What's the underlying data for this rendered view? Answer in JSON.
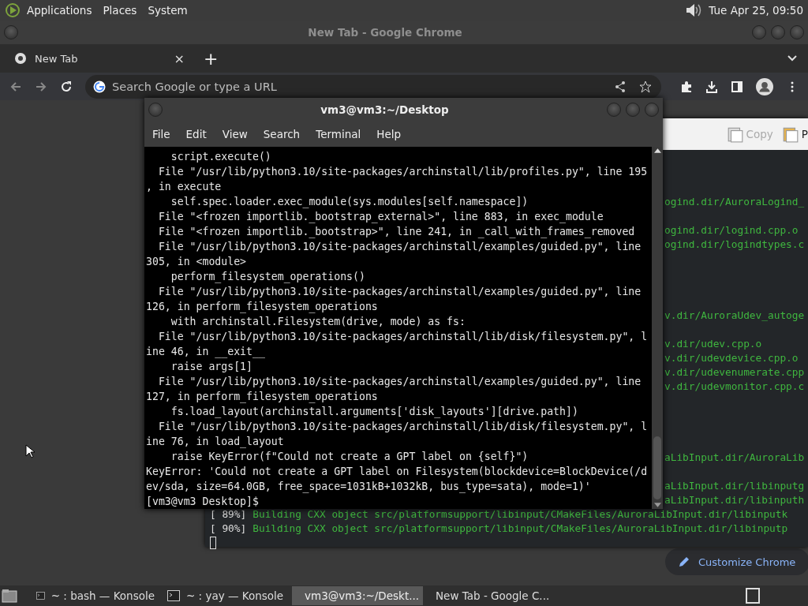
{
  "top_panel": {
    "menus": [
      "Applications",
      "Places",
      "System"
    ],
    "clock": "Tue Apr 25, 09:50"
  },
  "chrome": {
    "title": "New Tab - Google Chrome",
    "tabs": [
      {
        "label": "New Tab",
        "selected": true,
        "close": "×"
      }
    ],
    "new_tab": "+",
    "omnibox": {
      "placeholder": "Search Google or type a URL"
    },
    "customize_button": "Customize Chrome"
  },
  "konsole": {
    "toolbar": [
      {
        "label": "Copy",
        "disabled": true
      },
      {
        "label": "P",
        "disabled": false
      }
    ],
    "lines": [
      {
        "kind": "fragment",
        "text": "ogind.dir/AuroraLogind_"
      },
      {
        "kind": "fragment",
        "text": "ogind.dir/logind.cpp.o"
      },
      {
        "kind": "fragment",
        "text": "ogind.dir/logindtypes.c"
      },
      {
        "kind": "fragment",
        "text": "v.dir/AuroraUdev_autoge"
      },
      {
        "kind": "fragment",
        "text": "v.dir/udev.cpp.o"
      },
      {
        "kind": "fragment",
        "text": "v.dir/udevdevice.cpp.o"
      },
      {
        "kind": "fragment",
        "text": "v.dir/udevenumerate.cpp"
      },
      {
        "kind": "fragment",
        "text": "v.dir/udevmonitor.cpp.c"
      },
      {
        "kind": "fragment",
        "text": "aLibInput.dir/AuroraLib"
      },
      {
        "kind": "fragment",
        "text": "aLibInput.dir/libinputg"
      },
      {
        "kind": "fragment",
        "text": "aLibInput.dir/libinputh"
      },
      {
        "kind": "full",
        "percent": "[ 89%]",
        "text": "Building CXX object src/platformsupport/libinput/CMakeFiles/AuroraLibInput.dir/libinputk"
      },
      {
        "kind": "full",
        "percent": "[ 90%]",
        "text": "Building CXX object src/platformsupport/libinput/CMakeFiles/AuroraLibInput.dir/libinputp"
      }
    ]
  },
  "terminal": {
    "title": "vm3@vm3:~/Desktop",
    "menu": [
      "File",
      "Edit",
      "View",
      "Search",
      "Terminal",
      "Help"
    ],
    "lines": [
      "    script.execute()",
      "  File \"/usr/lib/python3.10/site-packages/archinstall/lib/profiles.py\", line 195",
      ", in execute",
      "    self.spec.loader.exec_module(sys.modules[self.namespace])",
      "  File \"<frozen importlib._bootstrap_external>\", line 883, in exec_module",
      "  File \"<frozen importlib._bootstrap>\", line 241, in _call_with_frames_removed",
      "  File \"/usr/lib/python3.10/site-packages/archinstall/examples/guided.py\", line",
      "305, in <module>",
      "    perform_filesystem_operations()",
      "  File \"/usr/lib/python3.10/site-packages/archinstall/examples/guided.py\", line",
      "126, in perform_filesystem_operations",
      "    with archinstall.Filesystem(drive, mode) as fs:",
      "  File \"/usr/lib/python3.10/site-packages/archinstall/lib/disk/filesystem.py\", l",
      "ine 46, in __exit__",
      "    raise args[1]",
      "  File \"/usr/lib/python3.10/site-packages/archinstall/examples/guided.py\", line",
      "127, in perform_filesystem_operations",
      "    fs.load_layout(archinstall.arguments['disk_layouts'][drive.path])",
      "  File \"/usr/lib/python3.10/site-packages/archinstall/lib/disk/filesystem.py\", l",
      "ine 76, in load_layout",
      "    raise KeyError(f\"Could not create a GPT label on {self}\")",
      "KeyError: 'Could not create a GPT label on Filesystem(blockdevice=BlockDevice(/d",
      "ev/sda, size=64.0GB, free_space=1031kB+1032kB, bus_type=sata), mode=1)'",
      "[vm3@vm3 Desktop]$ "
    ]
  },
  "taskbar": [
    {
      "label": "~ : bash — Konsole",
      "kind": "terminal",
      "selected": false
    },
    {
      "label": "~ : yay — Konsole",
      "kind": "terminal",
      "selected": false
    },
    {
      "label": "vm3@vm3:~/Deskt...",
      "kind": "terminal",
      "selected": true
    },
    {
      "label": "New Tab - Google C...",
      "kind": "browser",
      "selected": false
    }
  ]
}
